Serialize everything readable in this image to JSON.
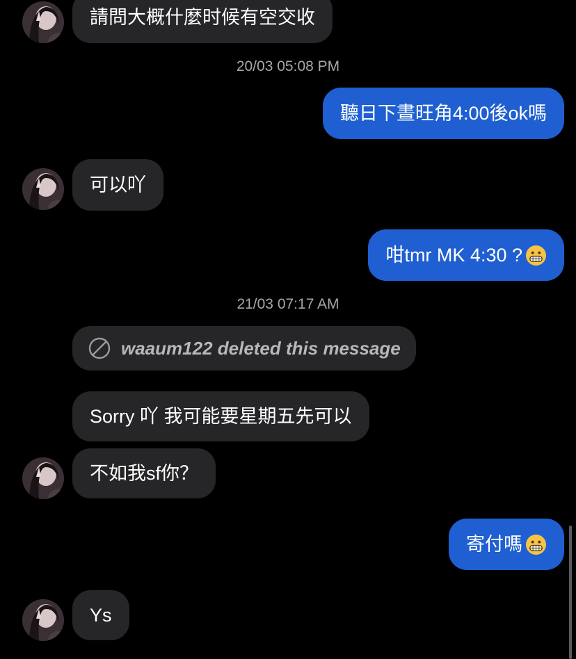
{
  "conversation": {
    "messages": [
      {
        "direction": "incoming",
        "text": "請問大概什麼时候有空交收"
      },
      {
        "timestamp": "20/03 05:08 PM"
      },
      {
        "direction": "outgoing",
        "text": "聽日下晝旺角4:00後ok嗎"
      },
      {
        "direction": "incoming",
        "text": "可以吖"
      },
      {
        "direction": "outgoing",
        "text": "咁tmr MK 4:30 ?",
        "emoji": "grimacing-face"
      },
      {
        "timestamp": "21/03 07:17 AM"
      },
      {
        "direction": "incoming",
        "deleted": true,
        "text": "waaum122 deleted this message"
      },
      {
        "direction": "incoming",
        "text": "Sorry 吖 我可能要星期五先可以"
      },
      {
        "direction": "incoming",
        "text": "不如我sf你？"
      },
      {
        "direction": "outgoing",
        "text": "寄付嗎",
        "emoji": "grimacing-face"
      },
      {
        "direction": "incoming",
        "text": "Ys"
      }
    ]
  },
  "colors": {
    "background": "#000000",
    "incoming_bubble": "#262628",
    "outgoing_bubble": "#1f5fd1",
    "timestamp_text": "#a6a6ab"
  },
  "icons": {
    "deleted": "ban-icon",
    "avatar": "user-avatar"
  }
}
